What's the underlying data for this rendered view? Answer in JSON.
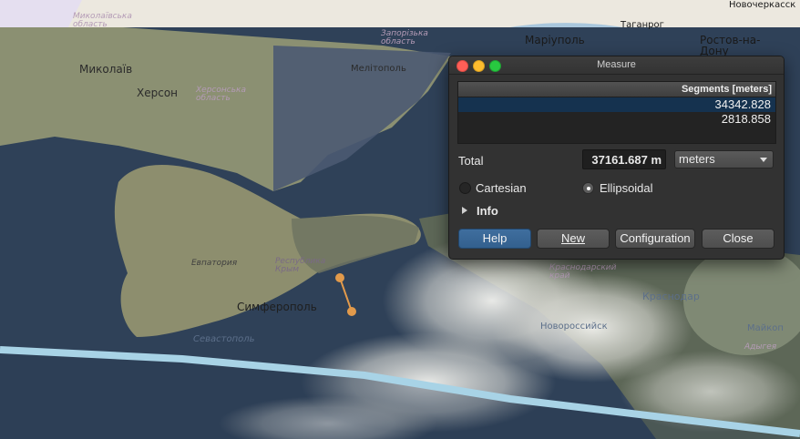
{
  "map": {
    "labels": {
      "mykolaiv_obl": "Миколаївська\nобласть",
      "zaporizhzhia_obl": "Запорізька\nобласть",
      "mykolaiv": "Миколаїв",
      "kherson": "Херсон",
      "kherson_obl": "Херсонська\nобласть",
      "melitopol": "Мелітополь",
      "mariupol": "Маріуполь",
      "taganrog": "Таганрог",
      "rostov": "Ростов-на-\nДону",
      "novocherkassk": "Новочеркасск",
      "yevpatoriya": "Евпатория",
      "crimea": "Республика\nКрым",
      "simferopol": "Симферополь",
      "sevastopol": "Севастополь",
      "krasnodar_krai": "Краснодарский\nкрай",
      "krasnodar": "Краснодар",
      "novorossiysk": "Новороссийск",
      "maikop": "Майкоп",
      "adygea": "Адыгея"
    },
    "colors": {
      "sea": "#2c3f55",
      "land": "#8e9474",
      "measure_line": "#e29a4b",
      "satellite_track": "#a9d4e6"
    }
  },
  "measure": {
    "title": "Measure",
    "column_header": "Segments [meters]",
    "segments": [
      "34342.828",
      "2818.858"
    ],
    "total_label": "Total",
    "total_value": "37161.687 m",
    "unit": "meters",
    "modes": {
      "cartesian": "Cartesian",
      "ellipsoidal": "Ellipsoidal",
      "selected": "ellipsoidal"
    },
    "info_label": "Info",
    "buttons": {
      "help": "Help",
      "new": "New",
      "configuration": "Configuration",
      "close": "Close"
    }
  }
}
